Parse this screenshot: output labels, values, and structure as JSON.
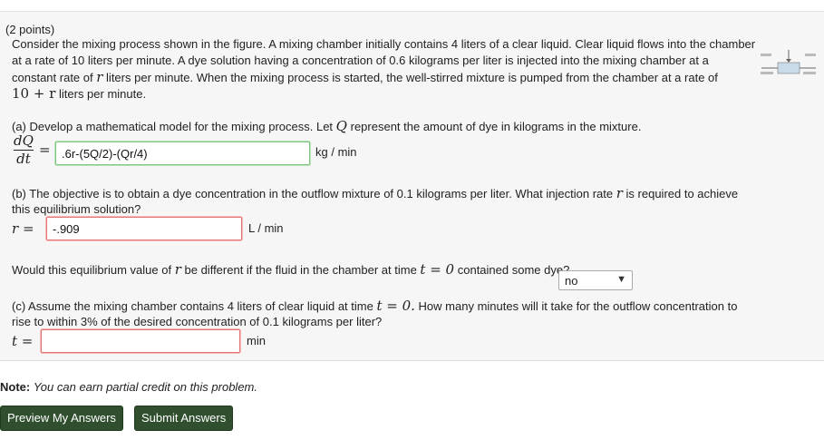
{
  "points": "(2 points)",
  "intro": {
    "line1": "Consider the mixing process shown in the figure. A mixing chamber initially contains 4 liters of a clear liquid. Clear liquid flows into the chamber",
    "line2a": "at a rate of 10 liters per minute. A dye solution having a concentration of 0.6 kilograms per liter is injected into the mixing chamber at a",
    "line3a": "constant rate of",
    "var_r": "r",
    "line3b": "liters per minute. When the mixing process is started, the well-stirred mixture is pumped from the chamber at a rate of",
    "line4_expr": "10 + r",
    "line4b": "liters per minute."
  },
  "part_a": {
    "text": "(a) Develop a mathematical model for the mixing process. Let",
    "var": "Q",
    "text2": "represent the amount of dye in kilograms in the mixture.",
    "frac_num": "dQ",
    "frac_den": "dt",
    "eq": "=",
    "answer": ".6r-(5Q/2)-(Qr/4)",
    "unit": "kg / min"
  },
  "part_b": {
    "line1a": "(b) The objective is to obtain a dye concentration in the outflow mixture of 0.1 kilograms per liter. What injection rate",
    "var": "r",
    "line1b": "is required to achieve",
    "line2": "this equilibrium solution?",
    "lhs": "r =",
    "answer": "-.909",
    "unit": "L / min"
  },
  "equilibrium_q": {
    "text_a": "Would this equilibrium value of",
    "var": "r",
    "text_b": "be different if the fluid in the chamber at time",
    "expr": "t = 0",
    "text_c": "contained some dye?",
    "select_value": "no"
  },
  "part_c": {
    "line1a": "(c) Assume the mixing chamber contains 4 liters of clear liquid at time",
    "expr": "t = 0.",
    "line1b": "How many minutes will it take for the outflow concentration to",
    "line2": "rise to within 3% of the desired concentration of 0.1 kilograms per liter?",
    "lhs": "t =",
    "answer": "",
    "unit": "min"
  },
  "note": {
    "bold": "Note:",
    "italic": "You can earn partial credit on this problem."
  },
  "buttons": {
    "preview": "Preview My Answers",
    "submit": "Submit Answers"
  },
  "colors": {
    "button_bg": "#2f4f2f",
    "correct_border": "#7ec77e",
    "incorrect_border": "#e57373"
  }
}
